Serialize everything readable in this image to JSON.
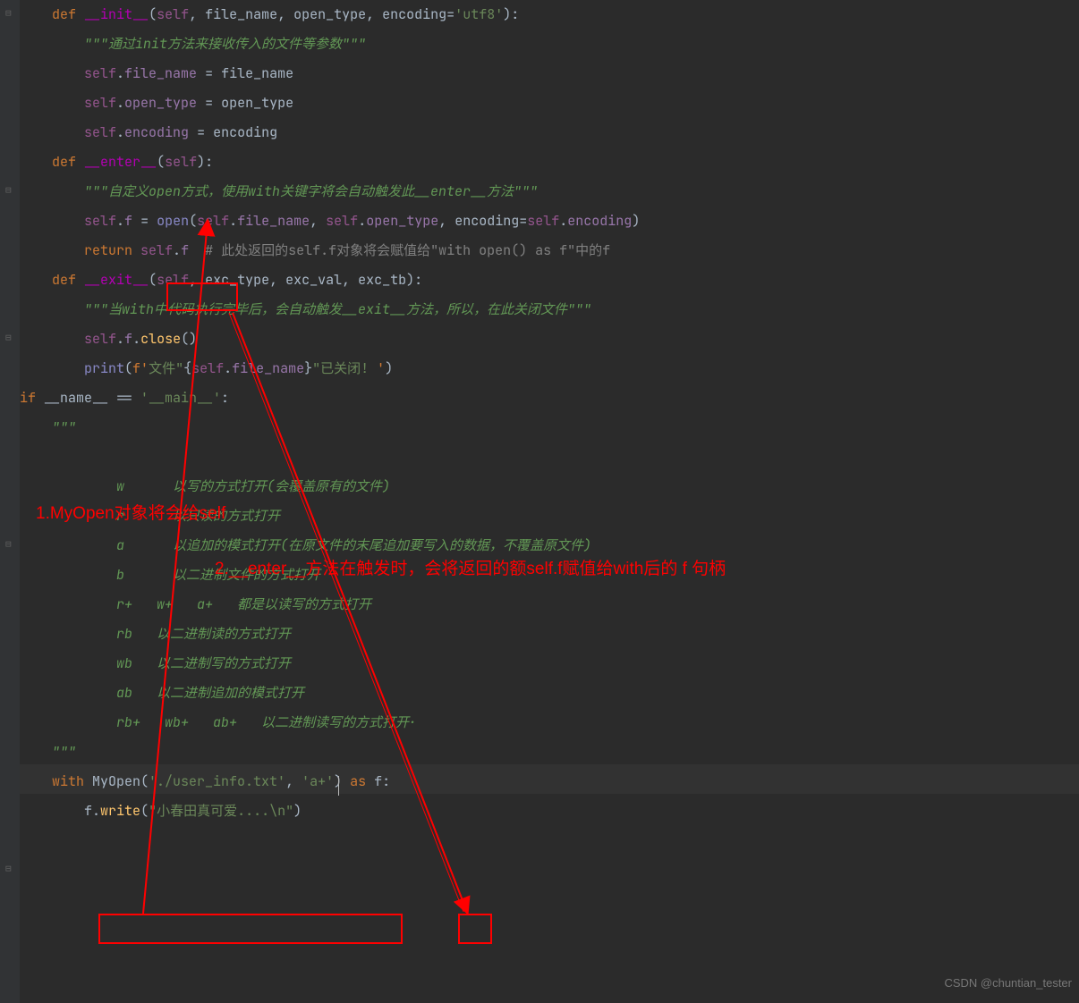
{
  "lines": [
    {
      "indent": 1,
      "tokens": [
        [
          "kw",
          "def "
        ],
        [
          "magic",
          "__init__"
        ],
        [
          "op",
          "("
        ],
        [
          "self",
          "self"
        ],
        [
          "op",
          ", "
        ],
        [
          "param",
          "file_name"
        ],
        [
          "op",
          ", "
        ],
        [
          "param",
          "open_type"
        ],
        [
          "op",
          ", "
        ],
        [
          "param",
          "encoding"
        ],
        [
          "op",
          "="
        ],
        [
          "str",
          "'utf8'"
        ],
        [
          "op",
          "):"
        ]
      ]
    },
    {
      "indent": 2,
      "tokens": [
        [
          "doc",
          "\"\"\"通过init方法来接收传入的文件等参数\"\"\""
        ]
      ]
    },
    {
      "indent": 2,
      "tokens": [
        [
          "self",
          "self"
        ],
        [
          "op",
          "."
        ],
        [
          "attr",
          "file_name"
        ],
        [
          "op",
          " = file_name"
        ]
      ]
    },
    {
      "indent": 2,
      "tokens": [
        [
          "self",
          "self"
        ],
        [
          "op",
          "."
        ],
        [
          "attr",
          "open_type"
        ],
        [
          "op",
          " = open_type"
        ]
      ]
    },
    {
      "indent": 2,
      "tokens": [
        [
          "self",
          "self"
        ],
        [
          "op",
          "."
        ],
        [
          "attr",
          "encoding"
        ],
        [
          "op",
          " = encoding"
        ]
      ]
    },
    {
      "indent": 0,
      "tokens": []
    },
    {
      "indent": 1,
      "tokens": [
        [
          "kw",
          "def "
        ],
        [
          "magic",
          "__enter__"
        ],
        [
          "op",
          "("
        ],
        [
          "self",
          "self"
        ],
        [
          "op",
          "):"
        ]
      ]
    },
    {
      "indent": 2,
      "tokens": [
        [
          "doc",
          "\"\"\"自定义open方式，使用with关键字将会自动触发此__enter__方法\"\"\""
        ]
      ]
    },
    {
      "indent": 2,
      "tokens": [
        [
          "self",
          "self"
        ],
        [
          "op",
          "."
        ],
        [
          "attr",
          "f"
        ],
        [
          "op",
          " = "
        ],
        [
          "builtin",
          "open"
        ],
        [
          "op",
          "("
        ],
        [
          "self",
          "self"
        ],
        [
          "op",
          "."
        ],
        [
          "attr",
          "file_name"
        ],
        [
          "op",
          ", "
        ],
        [
          "self",
          "self"
        ],
        [
          "op",
          "."
        ],
        [
          "attr",
          "open_type"
        ],
        [
          "op",
          ", "
        ],
        [
          "param",
          "encoding"
        ],
        [
          "op",
          "="
        ],
        [
          "self",
          "self"
        ],
        [
          "op",
          "."
        ],
        [
          "attr",
          "encoding"
        ],
        [
          "op",
          ")"
        ]
      ]
    },
    {
      "indent": 2,
      "tokens": [
        [
          "kw",
          "return "
        ],
        [
          "self",
          "self"
        ],
        [
          "op",
          "."
        ],
        [
          "attr",
          "f"
        ],
        [
          "op",
          "  "
        ],
        [
          "comment",
          "# 此处返回的self.f对象将会赋值给\"with open() as f\"中的f"
        ]
      ]
    },
    {
      "indent": 0,
      "tokens": []
    },
    {
      "indent": 1,
      "tokens": [
        [
          "kw",
          "def "
        ],
        [
          "magic",
          "__exit__"
        ],
        [
          "op",
          "("
        ],
        [
          "self",
          "self"
        ],
        [
          "op",
          ", "
        ],
        [
          "param",
          "exc_type"
        ],
        [
          "op",
          ", "
        ],
        [
          "param",
          "exc_val"
        ],
        [
          "op",
          ", "
        ],
        [
          "param",
          "exc_tb"
        ],
        [
          "op",
          "):"
        ]
      ]
    },
    {
      "indent": 2,
      "tokens": [
        [
          "doc",
          "\"\"\"当with中代码执行完毕后，会自动触发__exit__方法，所以，在此关闭文件\"\"\""
        ]
      ]
    },
    {
      "indent": 2,
      "tokens": [
        [
          "self",
          "self"
        ],
        [
          "op",
          "."
        ],
        [
          "attr",
          "f"
        ],
        [
          "op",
          "."
        ],
        [
          "func",
          "close"
        ],
        [
          "op",
          "()"
        ]
      ]
    },
    {
      "indent": 2,
      "tokens": [
        [
          "builtin",
          "print"
        ],
        [
          "op",
          "("
        ],
        [
          "strE",
          "f'"
        ],
        [
          "str",
          "文件\""
        ],
        [
          "op",
          "{"
        ],
        [
          "self",
          "self"
        ],
        [
          "op",
          "."
        ],
        [
          "attr",
          "file_name"
        ],
        [
          "op",
          "}"
        ],
        [
          "str",
          "\"已关闭! "
        ],
        [
          "strE",
          "'"
        ],
        [
          "op",
          ")"
        ]
      ]
    },
    {
      "indent": 0,
      "tokens": []
    },
    {
      "indent": 0,
      "tokens": []
    },
    {
      "indent": 0,
      "tokens": []
    },
    {
      "indent": 0,
      "tokens": [
        [
          "kw",
          "if "
        ],
        [
          "op",
          "__name__ == "
        ],
        [
          "str",
          "'__main__'"
        ],
        [
          "op",
          ":"
        ]
      ]
    },
    {
      "indent": 1,
      "tokens": [
        [
          "doc",
          "\"\"\""
        ]
      ]
    },
    {
      "indent": 1,
      "tokens": []
    },
    {
      "indent": 3,
      "tokens": [
        [
          "doc",
          "w      以写的方式打开(会覆盖原有的文件)"
        ]
      ]
    },
    {
      "indent": 3,
      "tokens": [
        [
          "doc",
          "r      以只读的方式打开"
        ]
      ]
    },
    {
      "indent": 3,
      "tokens": [
        [
          "doc",
          "a      以追加的模式打开(在原文件的末尾追加要写入的数据，不覆盖原文件)"
        ]
      ]
    },
    {
      "indent": 3,
      "tokens": [
        [
          "doc",
          "b      以二进制文件的方式打开"
        ]
      ]
    },
    {
      "indent": 3,
      "tokens": [
        [
          "doc",
          "r+   w+   a+   都是以读写的方式打开"
        ]
      ]
    },
    {
      "indent": 3,
      "tokens": [
        [
          "doc",
          "rb   以二进制读的方式打开"
        ]
      ]
    },
    {
      "indent": 3,
      "tokens": [
        [
          "doc",
          "wb   以二进制写的方式打开"
        ]
      ]
    },
    {
      "indent": 3,
      "tokens": [
        [
          "doc",
          "ab   以二进制追加的模式打开"
        ]
      ]
    },
    {
      "indent": 3,
      "tokens": [
        [
          "doc",
          "rb+   wb+   ab+   以二进制读写的方式打开·"
        ]
      ]
    },
    {
      "indent": 1,
      "tokens": [
        [
          "doc",
          "\"\"\""
        ]
      ]
    },
    {
      "indent": 1,
      "tokens": [
        [
          "kw",
          "with "
        ],
        [
          "op",
          "MyOpen("
        ],
        [
          "str",
          "'./user_info.txt'"
        ],
        [
          "op",
          ", "
        ],
        [
          "str",
          "'a+'"
        ],
        [
          "op",
          ") "
        ],
        [
          "kw",
          "as "
        ],
        [
          "op",
          "f:"
        ]
      ]
    },
    {
      "indent": 2,
      "tokens": [
        [
          "op",
          "f."
        ],
        [
          "func",
          "write"
        ],
        [
          "op",
          "("
        ],
        [
          "str",
          "\"小春田真可爱....\\n\""
        ],
        [
          "op",
          ")"
        ]
      ]
    }
  ],
  "annotations": {
    "note1": "1.MyOpen对象将会给self",
    "note2": "2.__enter__方法在触发时，会将返回的额self.f赋值给with后的 f 句柄"
  },
  "watermark": "CSDN @chuntian_tester"
}
